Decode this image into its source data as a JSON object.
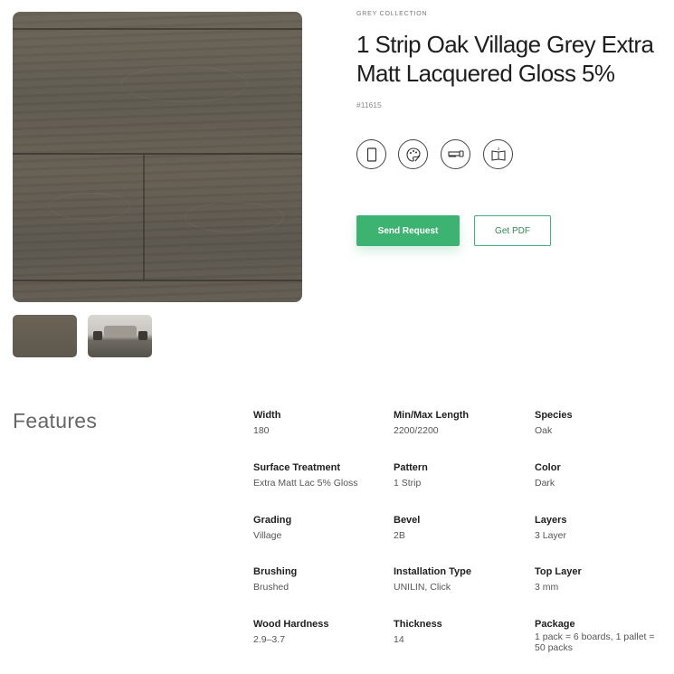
{
  "product": {
    "collection": "GREY COLLECTION",
    "title": "1 Strip Oak Village Grey Extra Matt Lacquered Gloss 5%",
    "sku": "#11615"
  },
  "icons": [
    "plank-icon",
    "palette-icon",
    "saw-icon",
    "book-icon"
  ],
  "actions": {
    "send_request": "Send Request",
    "get_pdf": "Get PDF"
  },
  "colors": {
    "accent": "#3cb371"
  },
  "features": {
    "heading": "Features",
    "items": [
      {
        "label": "Width",
        "value": "180"
      },
      {
        "label": "Min/Max Length",
        "value": "2200/2200"
      },
      {
        "label": "Species",
        "value": "Oak"
      },
      {
        "label": "Surface Treatment",
        "value": "Extra Matt Lac 5% Gloss"
      },
      {
        "label": "Pattern",
        "value": "1 Strip"
      },
      {
        "label": "Color",
        "value": "Dark"
      },
      {
        "label": "Grading",
        "value": "Village"
      },
      {
        "label": "Bevel",
        "value": "2B"
      },
      {
        "label": "Layers",
        "value": "3 Layer"
      },
      {
        "label": "Brushing",
        "value": "Brushed"
      },
      {
        "label": "Installation Type",
        "value": "UNILIN, Click"
      },
      {
        "label": "Top Layer",
        "value": "3 mm"
      },
      {
        "label": "Wood Hardness",
        "value": "2.9–3.7"
      },
      {
        "label": "Thickness",
        "value": "14"
      },
      {
        "label": "Package",
        "value": "1 pack = 6 boards, 1 pallet = 50 packs"
      }
    ]
  }
}
